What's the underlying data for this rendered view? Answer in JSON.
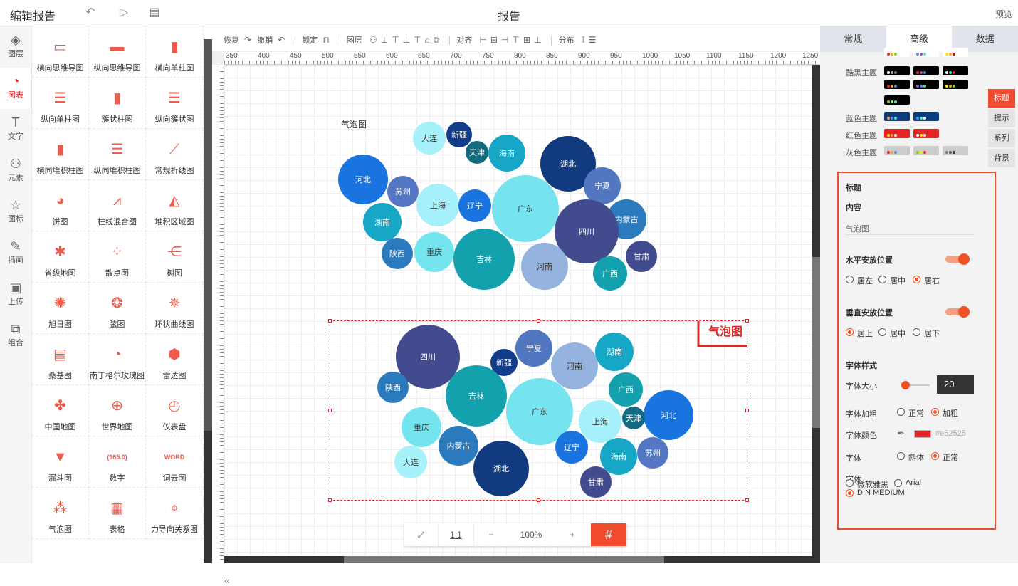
{
  "topbar": {
    "title": "编辑报告",
    "center": "报告",
    "preview": "预览"
  },
  "leftnav": [
    {
      "label": "图层",
      "icon": "layers-icon",
      "glyph": "◈"
    },
    {
      "label": "图表",
      "icon": "chart-icon",
      "glyph": "◔"
    },
    {
      "label": "文字",
      "icon": "text-icon",
      "glyph": "T"
    },
    {
      "label": "元素",
      "icon": "shapes-icon",
      "glyph": "⚇"
    },
    {
      "label": "图标",
      "icon": "star-icon",
      "glyph": "☆"
    },
    {
      "label": "插画",
      "icon": "palette-icon",
      "glyph": "✎"
    },
    {
      "label": "上传",
      "icon": "upload-image-icon",
      "glyph": "▣"
    },
    {
      "label": "组合",
      "icon": "group-icon",
      "glyph": "⧉"
    }
  ],
  "palette": [
    {
      "label": "横向思维导图",
      "glyph": "▭"
    },
    {
      "label": "纵向思维导图",
      "glyph": "▬"
    },
    {
      "label": "横向单柱图",
      "glyph": "▮"
    },
    {
      "label": "纵向单柱图",
      "glyph": "☰"
    },
    {
      "label": "簇状柱图",
      "glyph": "▮"
    },
    {
      "label": "纵向簇状图",
      "glyph": "☰"
    },
    {
      "label": "横向堆积柱图",
      "glyph": "▮"
    },
    {
      "label": "纵向堆积柱图",
      "glyph": "☰"
    },
    {
      "label": "常规折线图",
      "glyph": "⟋"
    },
    {
      "label": "饼图",
      "glyph": "◕"
    },
    {
      "label": "柱线混合图",
      "glyph": "⩘"
    },
    {
      "label": "堆积区域图",
      "glyph": "◭"
    },
    {
      "label": "省级地图",
      "glyph": "✱"
    },
    {
      "label": "散点图",
      "glyph": "⁘"
    },
    {
      "label": "树图",
      "glyph": "⋲"
    },
    {
      "label": "旭日图",
      "glyph": "✺"
    },
    {
      "label": "弦图",
      "glyph": "❂"
    },
    {
      "label": "环状曲线图",
      "glyph": "✵"
    },
    {
      "label": "桑基图",
      "glyph": "▤"
    },
    {
      "label": "南丁格尔玫瑰图",
      "glyph": "◔"
    },
    {
      "label": "雷达图",
      "glyph": "⬢"
    },
    {
      "label": "中国地图",
      "glyph": "✤"
    },
    {
      "label": "世界地图",
      "glyph": "⊕"
    },
    {
      "label": "仪表盘",
      "glyph": "◴"
    },
    {
      "label": "漏斗图",
      "glyph": "▼"
    },
    {
      "label": "数字",
      "glyph": "(965.0)"
    },
    {
      "label": "词云图",
      "glyph": "WORD"
    },
    {
      "label": "气泡图",
      "glyph": "⁂"
    },
    {
      "label": "表格",
      "glyph": "▦"
    },
    {
      "label": "力导向关系图",
      "glyph": "⌖"
    }
  ],
  "toolbar": {
    "restore": "恢复",
    "undo": "撤销",
    "lock": "锁定",
    "layer": "图层",
    "align": "对齐",
    "distribute": "分布"
  },
  "ruler": [
    "350",
    "400",
    "450",
    "500",
    "550",
    "600",
    "650",
    "700",
    "750",
    "800",
    "850",
    "900",
    "950",
    "1000",
    "1050",
    "1100",
    "1150",
    "1200",
    "1250"
  ],
  "chart1": {
    "title": "气泡图"
  },
  "chart2": {
    "title": "气泡图",
    "title_color": "#e52525"
  },
  "chart_data": [
    {
      "type": "scatter",
      "title": "气泡图",
      "series": [
        {
          "points": [
            {
              "name": "大连",
              "r": 23,
              "color": "#a7f2fa"
            },
            {
              "name": "新疆",
              "r": 18,
              "color": "#113c8a"
            },
            {
              "name": "天津",
              "r": 16,
              "color": "#136b82"
            },
            {
              "name": "海南",
              "r": 26,
              "color": "#16a6c6"
            },
            {
              "name": "湖北",
              "r": 39,
              "color": "#123a7e"
            },
            {
              "name": "河北",
              "r": 35,
              "color": "#1a74e0"
            },
            {
              "name": "苏州",
              "r": 22,
              "color": "#5377c2"
            },
            {
              "name": "宁夏",
              "r": 26,
              "color": "#5177c1"
            },
            {
              "name": "上海",
              "r": 30,
              "color": "#a6f0fb"
            },
            {
              "name": "辽宁",
              "r": 23,
              "color": "#1a74e0"
            },
            {
              "name": "广东",
              "r": 47,
              "color": "#75e4ef"
            },
            {
              "name": "内蒙古",
              "r": 28,
              "color": "#2a7abd"
            },
            {
              "name": "湖南",
              "r": 27,
              "color": "#16a6c6"
            },
            {
              "name": "四川",
              "r": 45,
              "color": "#424b8d"
            },
            {
              "name": "重庆",
              "r": 28,
              "color": "#74e4ef"
            },
            {
              "name": "吉林",
              "r": 43,
              "color": "#12a1ad"
            },
            {
              "name": "河南",
              "r": 33,
              "color": "#94b3de"
            },
            {
              "name": "陕西",
              "r": 22,
              "color": "#2a7abd"
            },
            {
              "name": "甘肃",
              "r": 22,
              "color": "#424b8d"
            },
            {
              "name": "广西",
              "r": 24,
              "color": "#12a1ad"
            }
          ]
        }
      ]
    },
    {
      "type": "scatter",
      "title": "气泡图",
      "series": [
        {
          "points": [
            {
              "name": "四川",
              "r": 45,
              "color": "#424b8d"
            },
            {
              "name": "新疆",
              "r": 19,
              "color": "#113c8a"
            },
            {
              "name": "宁夏",
              "r": 26,
              "color": "#5177c1"
            },
            {
              "name": "河南",
              "r": 33,
              "color": "#94b3de"
            },
            {
              "name": "湖南",
              "r": 27,
              "color": "#16a6c6"
            },
            {
              "name": "陕西",
              "r": 22,
              "color": "#2a7abd"
            },
            {
              "name": "吉林",
              "r": 43,
              "color": "#12a1ad"
            },
            {
              "name": "广东",
              "r": 47,
              "color": "#75e4ef"
            },
            {
              "name": "广西",
              "r": 24,
              "color": "#12a1ad"
            },
            {
              "name": "河北",
              "r": 35,
              "color": "#1a74e0"
            },
            {
              "name": "上海",
              "r": 30,
              "color": "#a6f0fb"
            },
            {
              "name": "天津",
              "r": 16,
              "color": "#136b82"
            },
            {
              "name": "重庆",
              "r": 28,
              "color": "#74e4ef"
            },
            {
              "name": "内蒙古",
              "r": 28,
              "color": "#2a7abd"
            },
            {
              "name": "辽宁",
              "r": 23,
              "color": "#1a74e0"
            },
            {
              "name": "海南",
              "r": 26,
              "color": "#16a6c6"
            },
            {
              "name": "苏州",
              "r": 22,
              "color": "#5377c2"
            },
            {
              "name": "大连",
              "r": 23,
              "color": "#a7f2fa"
            },
            {
              "name": "湖北",
              "r": 39,
              "color": "#123a7e"
            },
            {
              "name": "甘肃",
              "r": 22,
              "color": "#424b8d"
            }
          ]
        }
      ]
    }
  ],
  "zoom": {
    "fit": "⤢",
    "ratio": "1:1",
    "minus": "−",
    "value": "100%",
    "plus": "+",
    "grid": "#"
  },
  "rightpanel": {
    "tabs": [
      "常规",
      "高级",
      "数据"
    ],
    "themes": [
      {
        "label": "",
        "colors": [
          [
            "#e52525",
            "#f5a623",
            "#7ed321"
          ],
          [
            "#4a90e2",
            "#9b59b6",
            "#50e3c2"
          ],
          [
            "#f8e71c",
            "#f5a623",
            "#d0021b"
          ]
        ],
        "bg": "#fff"
      },
      {
        "label": "酷黑主题",
        "colors": [
          [
            "#fff",
            "#aaa",
            "#777"
          ],
          [
            "#e52525",
            "#9b59b6",
            "#4a90e2"
          ],
          [
            "#fff",
            "#50e3c2",
            "#e52525"
          ]
        ],
        "bg": "#000"
      },
      {
        "label": "",
        "colors": [
          [
            "#e52525",
            "#f5a623",
            "#4a90e2"
          ],
          [
            "#9b59b6",
            "#4a90e2",
            "#50e3c2"
          ],
          [
            "#f8e71c",
            "#f5a623",
            "#7ed321"
          ]
        ],
        "bg": "#000"
      },
      {
        "label": "",
        "colors": [
          [
            "#7ed321",
            "#b8e986",
            "#50e3c2"
          ]
        ],
        "bg": "#000"
      },
      {
        "label": "蓝色主题",
        "colors": [
          [
            "#f5a623",
            "#4a90e2",
            "#50e3c2"
          ],
          [
            "#4a90e2",
            "#50e3c2",
            "#fff"
          ]
        ],
        "bg": "#0c3d80"
      },
      {
        "label": "红色主题",
        "colors": [
          [
            "#f8e71c",
            "#f5a623",
            "#fff"
          ],
          [
            "#fff",
            "#f8e71c",
            "#fff"
          ]
        ],
        "bg": "#e52525"
      },
      {
        "label": "灰色主题",
        "colors": [
          [
            "#e52525",
            "#f5a623",
            "#4a90e2"
          ],
          [
            "#7ed321",
            "#f8e71c",
            "#e52525"
          ],
          [
            "#777",
            "#555",
            "#333"
          ]
        ],
        "bg": "#ccc"
      }
    ],
    "sidetabs": [
      "标题",
      "提示",
      "系列",
      "背景"
    ],
    "title_section": {
      "header": "标题",
      "content_label": "内容",
      "content_value": "气泡图",
      "h_pos": "水平安放位置",
      "h_options": [
        "居左",
        "居中",
        "居右"
      ],
      "h_selected": 2,
      "v_pos": "垂直安放位置",
      "v_options": [
        "居上",
        "居中",
        "居下"
      ],
      "v_selected": 0,
      "font_style": "字体样式",
      "font_size_label": "字体大小",
      "font_size": "20",
      "bold_label": "字体加粗",
      "bold_options": [
        "正常",
        "加粗"
      ],
      "bold_selected": 1,
      "color_label": "字体颜色",
      "color_value": "#e52525",
      "italic_label": "字体",
      "italic_options": [
        "斜体",
        "正常"
      ],
      "italic_selected": 1,
      "family_label": "字体",
      "family_options": [
        "微软雅黑",
        "Arial",
        "DIN MEDIUM"
      ],
      "family_selected": 2
    }
  }
}
